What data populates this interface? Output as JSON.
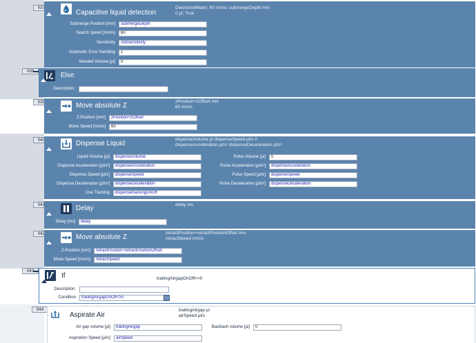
{
  "steps": {
    "s037": {
      "number": "037",
      "title": "Capacitive liquid detection",
      "summary1": "DeionizedWater; 60 mm/s; submergeDepth mm",
      "summary2": "0 µl; True",
      "icon": "water-drop-icon",
      "fields": [
        {
          "label": "Submerge Position [mm]",
          "value": "submergeDepth"
        },
        {
          "label": "Search speed [mm/s]",
          "value": "60"
        },
        {
          "label": "Sensitivity",
          "value": "clldSensitivity"
        },
        {
          "label": "Automatic Error Handling",
          "value": "1"
        },
        {
          "label": "Needed Volume [µl]",
          "value": "0"
        }
      ]
    },
    "s038": {
      "number": "038",
      "title": "Else",
      "icon": "else-branch-icon",
      "fields": [
        {
          "label": "Description:",
          "value": ""
        }
      ]
    },
    "s039": {
      "number": "039",
      "title": "Move absolute Z",
      "summary1": "zPosition+zOffset mm",
      "summary2": "60 mm/s",
      "icon": "move-arrow-icon",
      "fields": [
        {
          "label": "Z-Position [mm]",
          "value": "zPosition+zOffset"
        },
        {
          "label": "Move Speed [mm/s]",
          "value": "60"
        }
      ]
    },
    "s040": {
      "number": "040",
      "title": "Dispense Liquid",
      "summary1": "dispenseVolume µl  dispenseSpeed µl/s  0",
      "summary2": "dispenseAcceleration µl/s²  dispenseDeceleration µl/s²",
      "icon": "dispense-icon",
      "left_fields": [
        {
          "label": "Liquid Volume [µl]",
          "value": "dispenseVolume"
        },
        {
          "label": "Dispense Acceleration [µl/s²]",
          "value": "dispenseAcceleration"
        },
        {
          "label": "Dispense Speed [µl/s]",
          "value": "dispenseSpeed"
        },
        {
          "label": "Dispense Deceleration [µl/s²]",
          "value": "dispenseDeceleration"
        },
        {
          "label": "Use Tracking",
          "value": "dispensetrackingOnOff"
        }
      ],
      "right_fields": [
        {
          "label": "Pulse Volume [µl]",
          "value": "0"
        },
        {
          "label": "Pulse Acceleration [µl/s²]",
          "value": "dispenseAcceleration"
        },
        {
          "label": "Pulse Speed [µl/s]",
          "value": "dispenseSpeed"
        },
        {
          "label": "Pulse Deceleration [µl/s²]",
          "value": "dispenseDeceleration"
        }
      ]
    },
    "s041": {
      "number": "041",
      "title": "Delay",
      "summary1": "delay ms",
      "icon": "pause-icon",
      "fields": [
        {
          "label": "Delay [ms]",
          "value": "delay"
        }
      ]
    },
    "s042": {
      "number": "042",
      "title": "Move absolute Z",
      "summary1": "retractPosition+retractPositionOffset mm",
      "summary2": "retractSpeed mm/s",
      "icon": "move-arrow-icon",
      "fields": [
        {
          "label": "Z-Position [mm]",
          "value": "retractPosition+retractPositionOffset"
        },
        {
          "label": "Move Speed [mm/s]",
          "value": "retractSpeed"
        }
      ]
    },
    "s043": {
      "number": "043",
      "title": "If",
      "summary1": "trailingAirgapOnOff<>0",
      "icon": "if-branch-icon",
      "fields": [
        {
          "label": "Description:",
          "value": ""
        },
        {
          "label": "Condition",
          "value": "trailingAirgapOnOff<>0"
        }
      ],
      "condition_button": "..."
    },
    "s044": {
      "number": "044",
      "title": "Aspirate Air",
      "summary1": "trailingAirgap µl",
      "summary2": "airSpeed µl/s",
      "icon": "aspirate-icon",
      "left_fields": [
        {
          "label": "Air gap volume [µl]",
          "value": "trailingAirgap"
        },
        {
          "label": "Aspiration Speed [µl/s]",
          "value": "airSpeed"
        }
      ],
      "right_fields": [
        {
          "label": "Backlash volume [µl]",
          "value": "0"
        }
      ]
    }
  }
}
